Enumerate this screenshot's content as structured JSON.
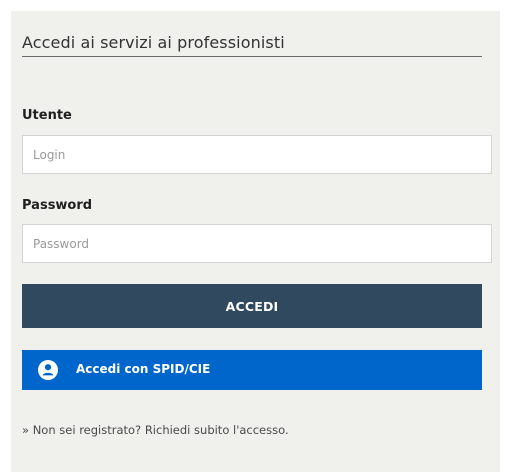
{
  "login_panel": {
    "title": "Accedi ai servizi ai professionisti",
    "username": {
      "label": "Utente",
      "placeholder": "Login",
      "value": ""
    },
    "password": {
      "label": "Password",
      "placeholder": "Password",
      "value": ""
    },
    "submit_label": "ACCEDI",
    "spid": {
      "label": "Accedi con SPID/CIE",
      "icon": "user-circle-icon"
    },
    "register_link": "» Non sei registrato? Richiedi subito l'accesso."
  },
  "colors": {
    "panel_background": "#f0f0ed",
    "submit_button": "#30495f",
    "spid_button": "#0066cc",
    "button_text": "#ffffff"
  }
}
